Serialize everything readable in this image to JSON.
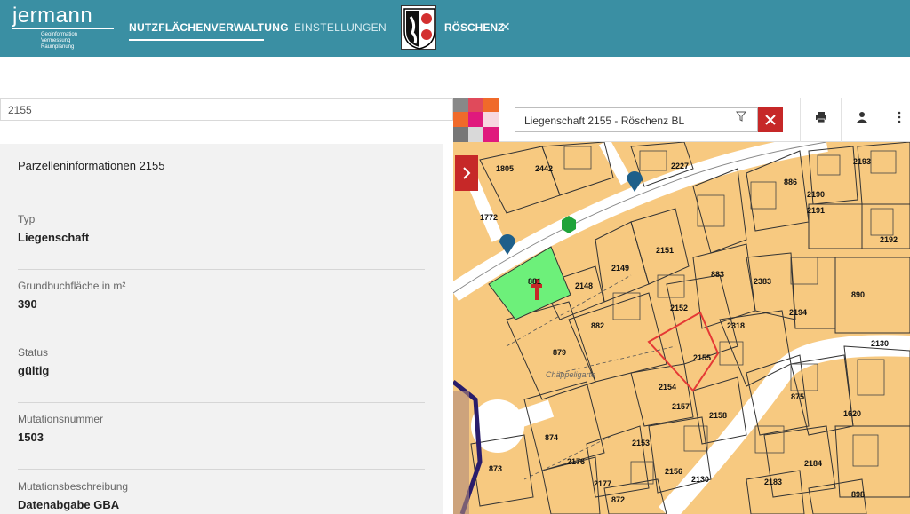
{
  "header": {
    "brand": "jermann",
    "tagline": [
      "Geoinformation",
      "Vermessung",
      "Raumplanung"
    ],
    "nav": {
      "active": "NUTZFLÄCHENVERWALTUNG",
      "second": "EINSTELLUNGEN"
    },
    "town": "RÖSCHENZ",
    "town_close": "✕"
  },
  "left_search": {
    "value": "2155"
  },
  "panel": {
    "title": "Parzelleninformationen 2155",
    "fields": [
      {
        "label": "Typ",
        "value": "Liegenschaft"
      },
      {
        "label": "Grundbuchfläche in m²",
        "value": "390"
      },
      {
        "label": "Status",
        "value": "gültig"
      },
      {
        "label": "Mutationsnummer",
        "value": "1503"
      },
      {
        "label": "Mutationsbeschreibung",
        "value": "Datenabgabe GBA"
      }
    ]
  },
  "map": {
    "search_value": "Liegenschaft 2155 - Röschenz BL",
    "icons": {
      "filter": "funnel-icon",
      "close": "close-icon",
      "print": "print-icon",
      "user": "user-icon",
      "menu": "more-vert-icon",
      "expand": "chevron-right-icon"
    },
    "labels": [
      "1805",
      "2442",
      "2227",
      "1772",
      "886",
      "2190",
      "2191",
      "2192",
      "2193",
      "2149",
      "2151",
      "881",
      "2148",
      "883",
      "2383",
      "890",
      "2194",
      "882",
      "2152",
      "2318",
      "2130",
      "879",
      "2155",
      "Chäppeligarte",
      "2154",
      "2157",
      "2158",
      "875",
      "1620",
      "874",
      "2153",
      "2176",
      "2184",
      "873",
      "2156",
      "2130",
      "2177",
      "872",
      "2183",
      "898"
    ],
    "colors": {
      "parcel": "#f7c980",
      "highlight": "#e53935",
      "green": "#6df07a",
      "road": "#ffffff"
    }
  }
}
